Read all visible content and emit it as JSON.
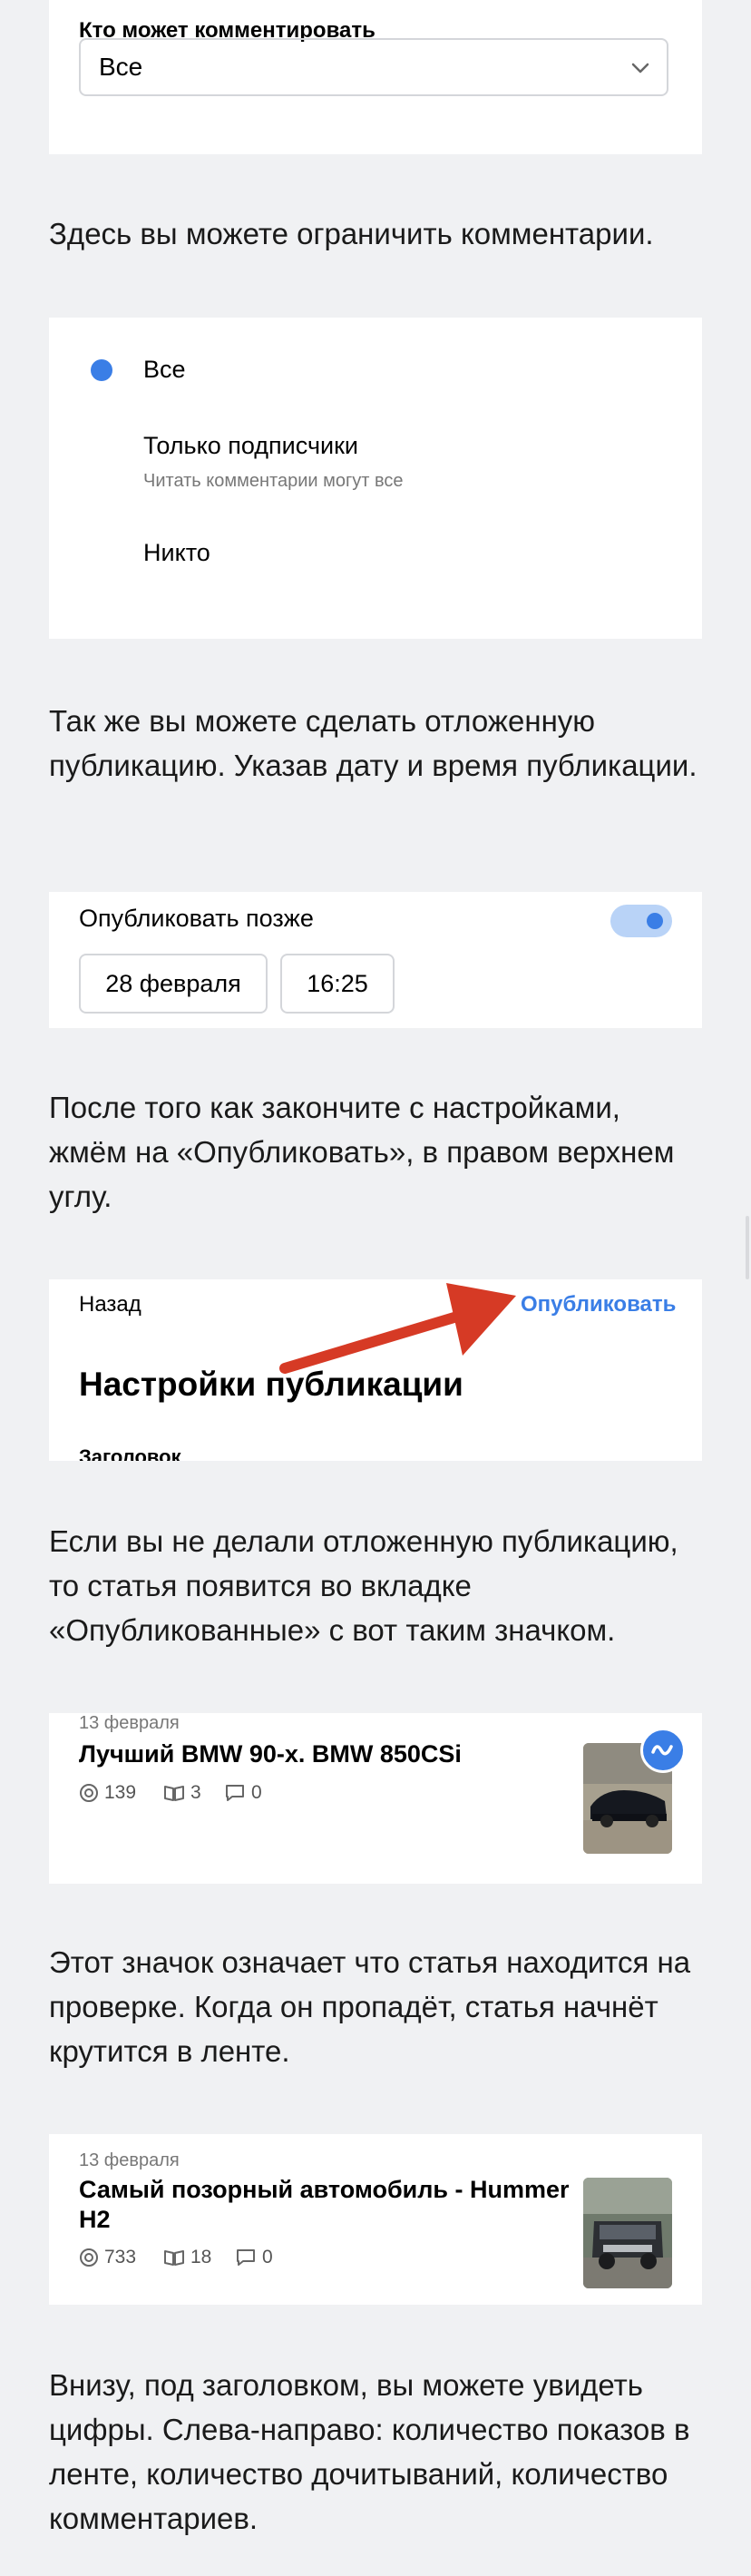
{
  "comments_select": {
    "label": "Кто может комментировать",
    "value": "Все"
  },
  "p1": "Здесь вы можете ограничить комментарии.",
  "comments_options": {
    "opt_all": "Все",
    "opt_subs": "Только подписчики",
    "opt_subs_hint": "Читать комментарии могут все",
    "opt_none": "Никто"
  },
  "p2": "Так же вы можете сделать отложенную публикацию. Указав дату и время публикации.",
  "schedule": {
    "label": "Опубликовать позже",
    "date": "28 февраля",
    "time": "16:25"
  },
  "p3": "После того как закончите с настройками, жмём на «Опубликовать», в правом верхнем углу.",
  "publish_header": {
    "back": "Назад",
    "publish": "Опубликовать",
    "title": "Настройки публикации",
    "cut_label": "Заголовок"
  },
  "p4": "Если вы не делали отложенную публикацию, то статья появится во вкладке «Опубликованные» с вот таким значком.",
  "article1": {
    "date": "13 февраля",
    "title": "Лучший BMW 90-х. BMW 850CSi",
    "views": "139",
    "reads": "3",
    "comments": "0"
  },
  "p5": "Этот значок означает что статья находится на проверке. Когда он пропадёт, статья начнёт крутится в ленте.",
  "article2": {
    "date": "13 февраля",
    "title_line1": "Самый позорный автомобиль - Hummer",
    "title_line2": "H2",
    "views": "733",
    "reads": "18",
    "comments": "0"
  },
  "p6": "Внизу, под заголовком, вы можете увидеть цифры. Слева-направо: количество показов в ленте, количество дочитываний, количество комментариев.",
  "colors": {
    "accent": "#3a7ee6",
    "arrow": "#d63a25",
    "background": "#f0f1f3"
  }
}
